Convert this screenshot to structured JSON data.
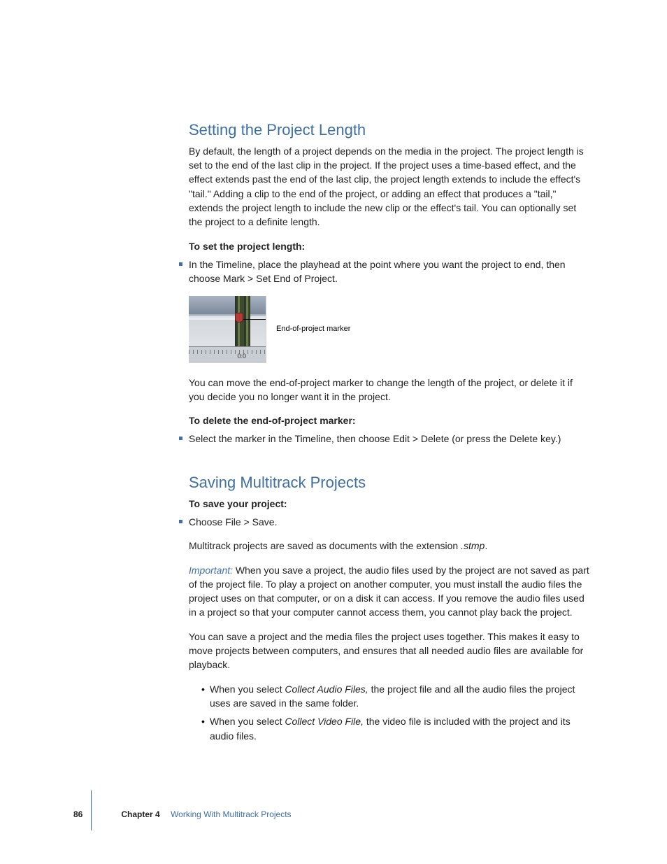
{
  "section1": {
    "heading": "Setting the Project Length",
    "intro": "By default, the length of a project depends on the media in the project. The project length is set to the end of the last clip in the project. If the project uses a time-based effect, and the effect extends past the end of the last clip, the project length extends to include the effect's \"tail.\" Adding a clip to the end of the project, or adding an effect that produces a \"tail,\" extends the project length to include the new clip or the effect's tail. You can optionally set the project to a definite length.",
    "proc1_title": "To set the project length:",
    "proc1_step": "In the Timeline, place the playhead at the point where you want the project to end, then choose Mark > Set End of Project.",
    "figure_caption": "End-of-project marker",
    "figure_zero": "0:0",
    "after_figure": "You can move the end-of-project marker to change the length of the project, or delete it if you decide you no longer want it in the project.",
    "proc2_title": "To delete the end-of-project marker:",
    "proc2_step": "Select the marker in the Timeline, then choose Edit > Delete (or press the Delete key.)"
  },
  "section2": {
    "heading": "Saving Multitrack Projects",
    "proc_title": "To save your project:",
    "proc_step": "Choose File > Save.",
    "para1_pre": "Multitrack projects are saved as documents with the extension ",
    "para1_ext": ".stmp",
    "para1_post": ".",
    "important_label": "Important:",
    "important_body": "  When you save a project, the audio files used by the project are not saved as part of the project file. To play a project on another computer, you must install the audio files the project uses on that computer, or on a disk it can access. If you remove the audio files used in a project so that your computer cannot access them, you cannot play back the project.",
    "para2": "You can save a project and the media files the project uses together. This makes it easy to move projects between computers, and ensures that all needed audio files are available for playback.",
    "dot1_pre": "When you select ",
    "dot1_em": "Collect Audio Files,",
    "dot1_post": " the project file and all the audio files the project uses are saved in the same folder.",
    "dot2_pre": "When you select ",
    "dot2_em": "Collect Video File,",
    "dot2_post": " the video file is included with the project and its audio files."
  },
  "footer": {
    "page_number": "86",
    "chapter_label": "Chapter 4",
    "chapter_title": "Working With Multitrack Projects"
  }
}
